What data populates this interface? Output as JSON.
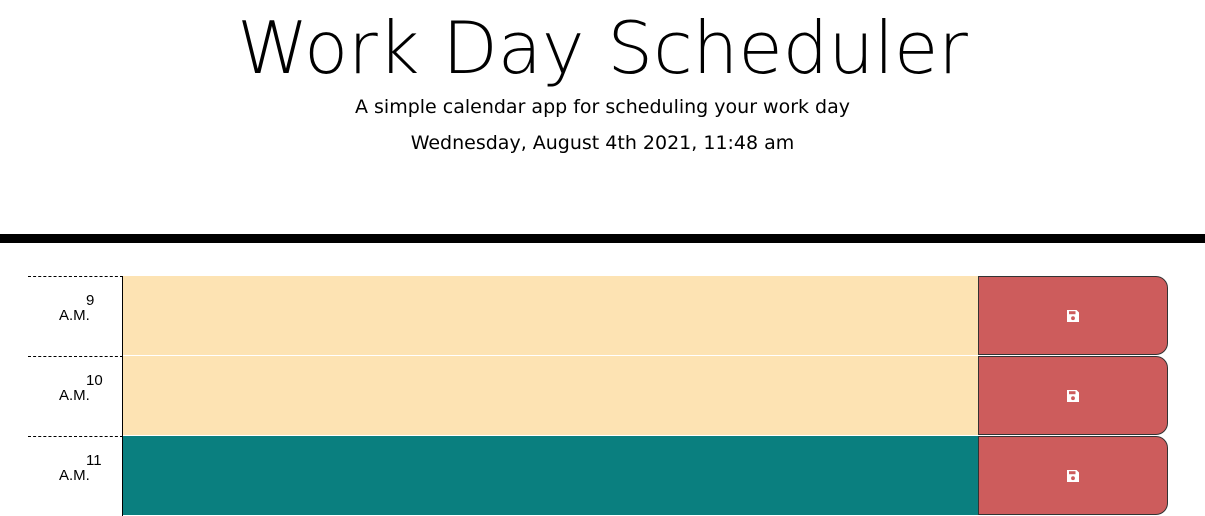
{
  "header": {
    "title": "Work Day Scheduler",
    "subtitle": "A simple calendar app for scheduling your work day",
    "current_day": "Wednesday, August 4th 2021, 11:48 am"
  },
  "timeblocks": [
    {
      "hour": "9",
      "meridiem": "A.M.",
      "description": "",
      "status": "future"
    },
    {
      "hour": "10",
      "meridiem": "A.M.",
      "description": "",
      "status": "future"
    },
    {
      "hour": "11",
      "meridiem": "A.M.",
      "description": "",
      "status": "present"
    }
  ],
  "colors": {
    "future": "#fde3b3",
    "present": "#0a7f7f",
    "save_button": "#cd5c5c",
    "divider": "#000000"
  },
  "icons": {
    "save": "floppy-disk-icon"
  }
}
